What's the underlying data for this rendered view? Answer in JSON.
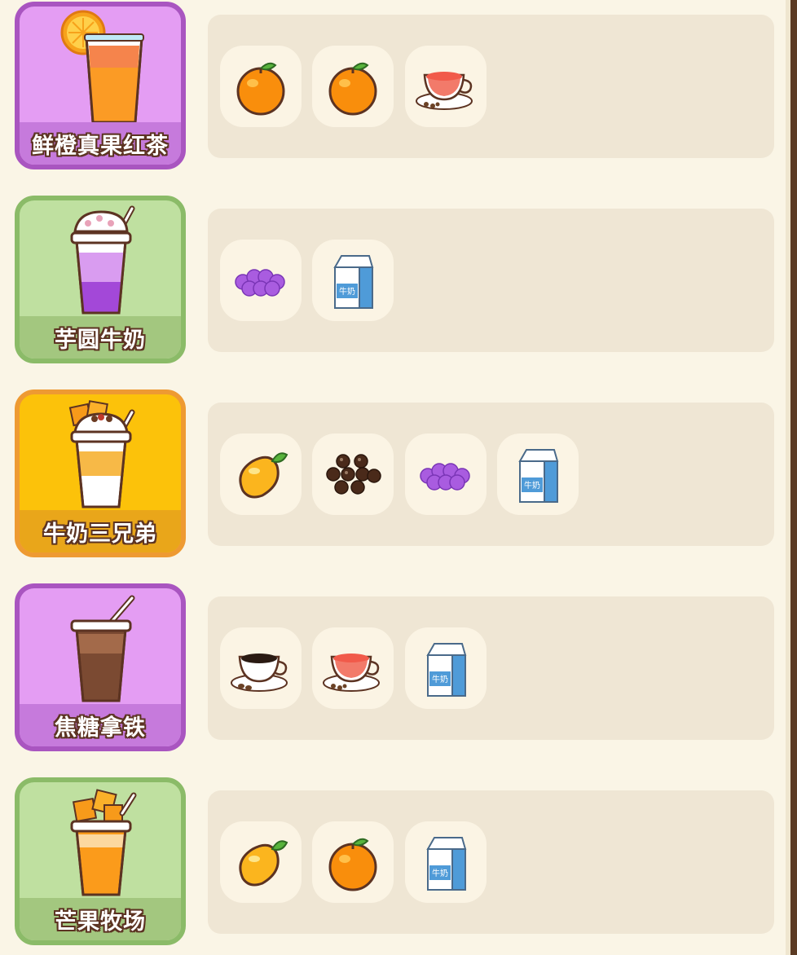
{
  "recipes": [
    {
      "name": "鲜橙真果红茶",
      "card_color": "purple",
      "drink_icon": "orange-tea-drink-icon",
      "ingredients": [
        "orange-icon",
        "orange-icon",
        "red-tea-icon"
      ]
    },
    {
      "name": "芋圆牛奶",
      "card_color": "green",
      "drink_icon": "taro-ball-milk-drink-icon",
      "ingredients": [
        "taro-balls-icon",
        "milk-carton-icon"
      ]
    },
    {
      "name": "牛奶三兄弟",
      "card_color": "yellow",
      "drink_icon": "milk-three-brothers-drink-icon",
      "ingredients": [
        "mango-icon",
        "tapioca-pearls-icon",
        "taro-balls-icon",
        "milk-carton-icon"
      ]
    },
    {
      "name": "焦糖拿铁",
      "card_color": "purple",
      "drink_icon": "caramel-latte-drink-icon",
      "ingredients": [
        "coffee-icon",
        "red-tea-icon",
        "milk-carton-icon"
      ]
    },
    {
      "name": "芒果牧场",
      "card_color": "green",
      "drink_icon": "mango-ranch-drink-icon",
      "ingredients": [
        "mango-icon",
        "orange-icon",
        "milk-carton-icon"
      ]
    }
  ],
  "milk_carton_text": "牛奶",
  "colors": {
    "background": "#faf5e6",
    "panel": "#efe6d4",
    "tile": "#fbf4e4",
    "outline": "#5c3322"
  }
}
